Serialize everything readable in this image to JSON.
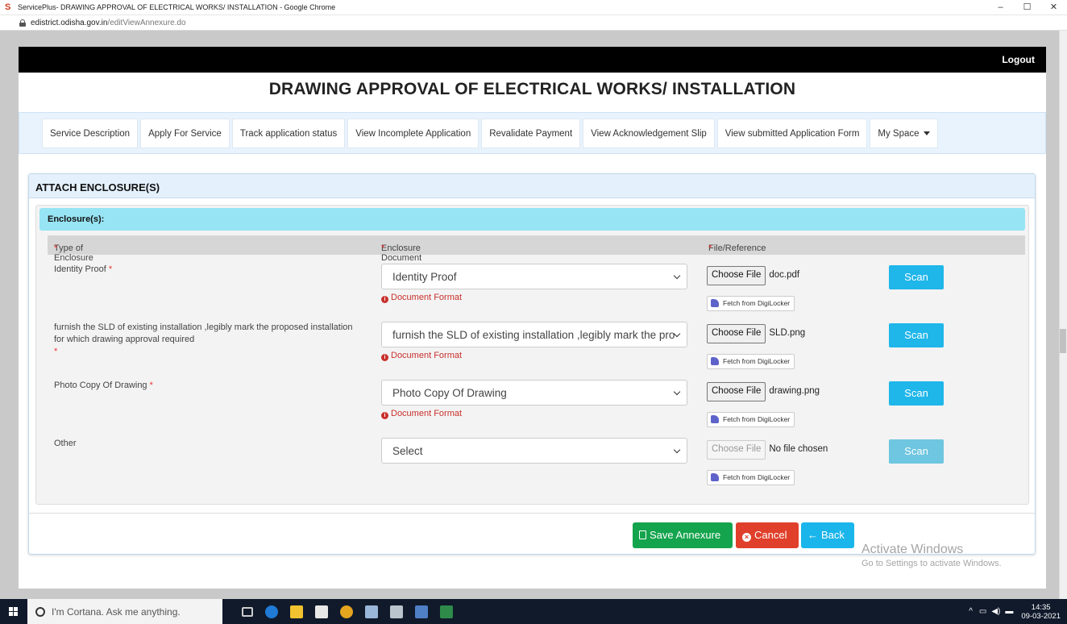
{
  "browser": {
    "window_title": "ServicePlus- DRAWING APPROVAL OF ELECTRICAL WORKS/ INSTALLATION - Google Chrome",
    "url_domain": "edistrict.odisha.gov.in",
    "url_path": "/editViewAnnexure.do",
    "minimize": "–",
    "maximize": "☐",
    "close": "✕"
  },
  "header": {
    "logout": "Logout",
    "title": "DRAWING APPROVAL OF ELECTRICAL WORKS/ INSTALLATION"
  },
  "nav": {
    "items": [
      "Service Description",
      "Apply For Service",
      "Track application status",
      "View Incomplete Application",
      "Revalidate Payment",
      "View Acknowledgement Slip",
      "View submitted Application Form",
      "My Space"
    ]
  },
  "panel": {
    "title": "ATTACH ENCLOSURE(S)",
    "enclosures_header": "Enclosure(s):",
    "columns": {
      "type": "Type of Enclosure",
      "document": "Enclosure Document",
      "file": "File/Reference"
    },
    "required_mark": "*",
    "rows": [
      {
        "type": "Identity Proof",
        "document": "Identity Proof",
        "format_label": "Document Format",
        "choose_label": "Choose File",
        "file_name": "doc.pdf",
        "scan_label": "Scan",
        "digilocker_label": "Fetch from DigiLocker"
      },
      {
        "type": "furnish the SLD of existing installation ,legibly mark the proposed installation for which drawing approval required",
        "document": "furnish the SLD of existing installation ,legibly mark the pro",
        "format_label": "Document Format",
        "choose_label": "Choose File",
        "file_name": "SLD.png",
        "scan_label": "Scan",
        "digilocker_label": "Fetch from DigiLocker"
      },
      {
        "type": "Photo Copy Of Drawing",
        "document": "Photo Copy Of Drawing",
        "format_label": "Document Format",
        "choose_label": "Choose File",
        "file_name": "drawing.png",
        "scan_label": "Scan",
        "digilocker_label": "Fetch from DigiLocker"
      },
      {
        "type": "Other",
        "document": "Select",
        "choose_label": "Choose File",
        "file_name": "No file chosen",
        "scan_label": "Scan",
        "digilocker_label": "Fetch from DigiLocker"
      }
    ],
    "buttons": {
      "save": "Save Annexure",
      "cancel": "Cancel",
      "back": "Back"
    }
  },
  "watermark": {
    "line1": "Activate Windows",
    "line2": "Go to Settings to activate Windows."
  },
  "taskbar": {
    "search_placeholder": "I'm Cortana. Ask me anything.",
    "time": "14:35",
    "date": "09-03-2021"
  },
  "colors": {
    "save": "#14a44d",
    "cancel": "#e0402b",
    "back": "#1ab5ea",
    "scan": "#1fb6ea",
    "enclosure_header": "#97e4f4"
  }
}
